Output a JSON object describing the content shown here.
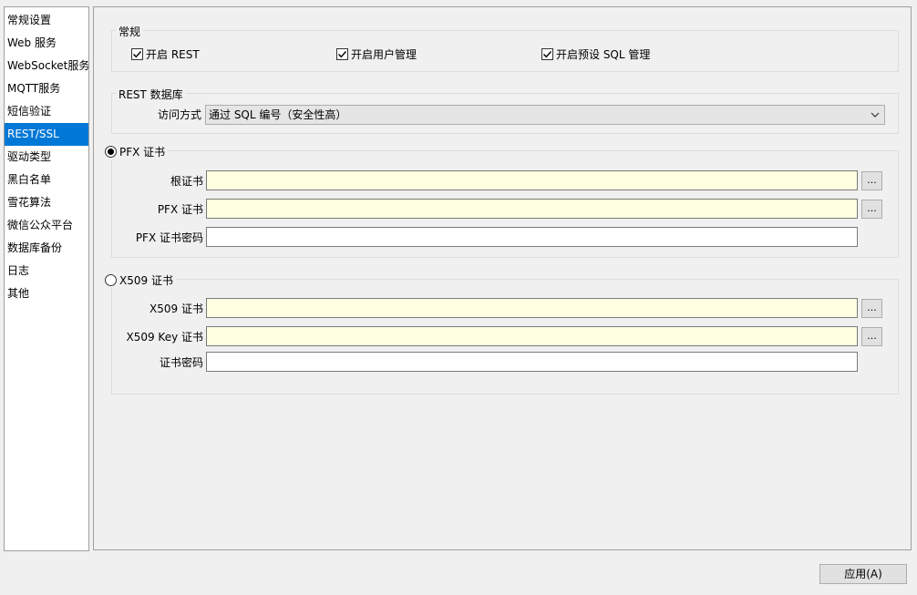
{
  "sidebar": {
    "items": [
      {
        "label": "常规设置"
      },
      {
        "label": "Web 服务"
      },
      {
        "label": "WebSocket服务"
      },
      {
        "label": "MQTT服务"
      },
      {
        "label": "短信验证"
      },
      {
        "label": "REST/SSL",
        "selected": true
      },
      {
        "label": "驱动类型"
      },
      {
        "label": "黑白名单"
      },
      {
        "label": "雪花算法"
      },
      {
        "label": "微信公众平台"
      },
      {
        "label": "数据库备份"
      },
      {
        "label": "日志"
      },
      {
        "label": "其他"
      }
    ]
  },
  "general": {
    "title": "常规",
    "enable_rest": {
      "label": "开启 REST",
      "checked": true
    },
    "enable_user_mgmt": {
      "label": "开启用户管理",
      "checked": true
    },
    "enable_preset_sql": {
      "label": "开启预设 SQL 管理",
      "checked": true
    }
  },
  "rest_db": {
    "title": "REST 数据库",
    "access_label": "访问方式",
    "access_value": "通过 SQL 编号（安全性高）"
  },
  "pfx": {
    "title": "PFX 证书",
    "selected": true,
    "root_cert_label": "根证书",
    "root_cert_value": "",
    "pfx_cert_label": "PFX 证书",
    "pfx_cert_value": "",
    "pfx_password_label": "PFX 证书密码",
    "pfx_password_value": ""
  },
  "x509": {
    "title": "X509 证书",
    "selected": false,
    "cert_label": "X509 证书",
    "cert_value": "",
    "key_label": "X509 Key 证书",
    "key_value": "",
    "password_label": "证书密码",
    "password_value": ""
  },
  "browse_label": "...",
  "apply_label": "应用(A)",
  "colors": {
    "selection": "#0078d7",
    "required_field": "#ffffe1",
    "window_bg": "#f0f0f0"
  }
}
